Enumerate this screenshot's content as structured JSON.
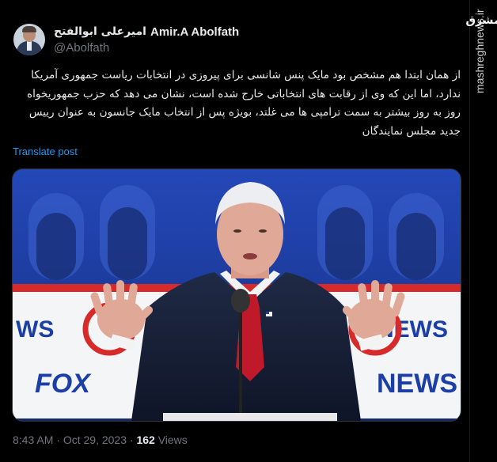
{
  "author": {
    "name_fa": "امیرعلی ابوالفتح",
    "name_en": "Amir.A Abolfath",
    "handle": "@Abolfath",
    "avatar_icon": "profile-photo"
  },
  "post": {
    "text": "از همان ابتدا هم مشخص بود مایک پنس شانسی برای پیروزی در انتخابات ریاست جمهوری آمریکا ندارد، اما این که وی از رقابت های انتخاباتی خارج شده است، نشان می دهد که حزب جمهوریخواه روز به روز بیشتر به سمت ترامپی ها می غلتد، بویژه پس از انتخاب مایک جانسون به عنوان رییس جدید مجلس نمایندگان",
    "translate_label": "Translate post"
  },
  "media": {
    "banner_left": "WS",
    "banner_right": "NEWS",
    "banner_fox": "FOX",
    "banner_news_lower": "NEWS",
    "colors": {
      "backdrop": "#1c3b9c",
      "banner": "#ffffff",
      "accent": "#d72a2a"
    }
  },
  "meta": {
    "time": "8:43 AM",
    "separator": "·",
    "date": "Oct 29, 2023",
    "views_count": "162",
    "views_label": "Views"
  },
  "watermark": {
    "logo": "مشرق",
    "site": "mashreghnews.ir"
  },
  "colors": {
    "background": "#000000",
    "text": "#e7e9ea",
    "secondary": "#71767b",
    "link": "#1d9bf0"
  }
}
